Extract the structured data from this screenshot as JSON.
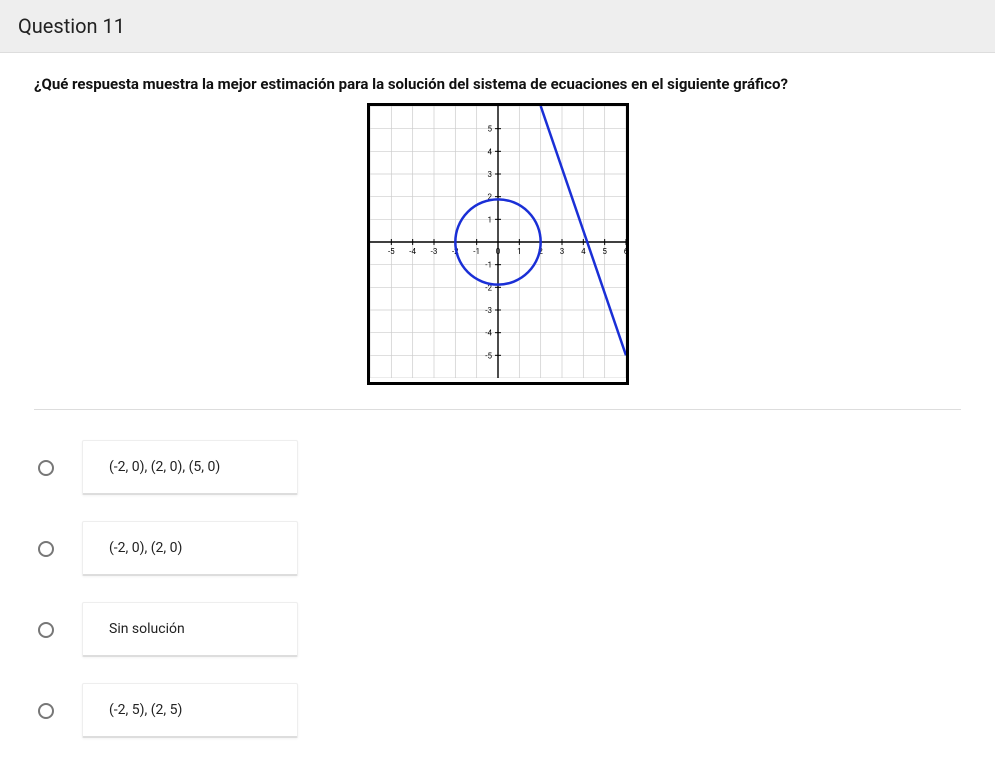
{
  "header": {
    "title": "Question 11"
  },
  "question": {
    "prompt": "¿Qué respuesta muestra la mejor estimación para la solución del sistema de ecuaciones en el siguiente gráfico?"
  },
  "chart_data": {
    "type": "scatter",
    "title": "",
    "xlabel": "",
    "ylabel": "",
    "xlim": [
      -6,
      6
    ],
    "ylim": [
      -6,
      6
    ],
    "x_ticks": [
      -5,
      -4,
      -3,
      -2,
      -1,
      0,
      1,
      2,
      3,
      4,
      5,
      6
    ],
    "y_ticks": [
      -5,
      -4,
      -3,
      -2,
      -1,
      0,
      1,
      2,
      3,
      4,
      5
    ],
    "series": [
      {
        "name": "circle",
        "kind": "circle",
        "center": [
          0,
          0
        ],
        "radius": 2,
        "color": "#1a2fd6"
      },
      {
        "name": "line",
        "kind": "line",
        "points": [
          [
            2,
            6
          ],
          [
            6,
            -5
          ]
        ],
        "color": "#1a2fd6"
      }
    ]
  },
  "answers": {
    "options": [
      "(-2, 0), (2, 0), (5, 0)",
      "(-2, 0), (2, 0)",
      "Sin solución",
      "(-2, 5), (2, 5)"
    ]
  }
}
